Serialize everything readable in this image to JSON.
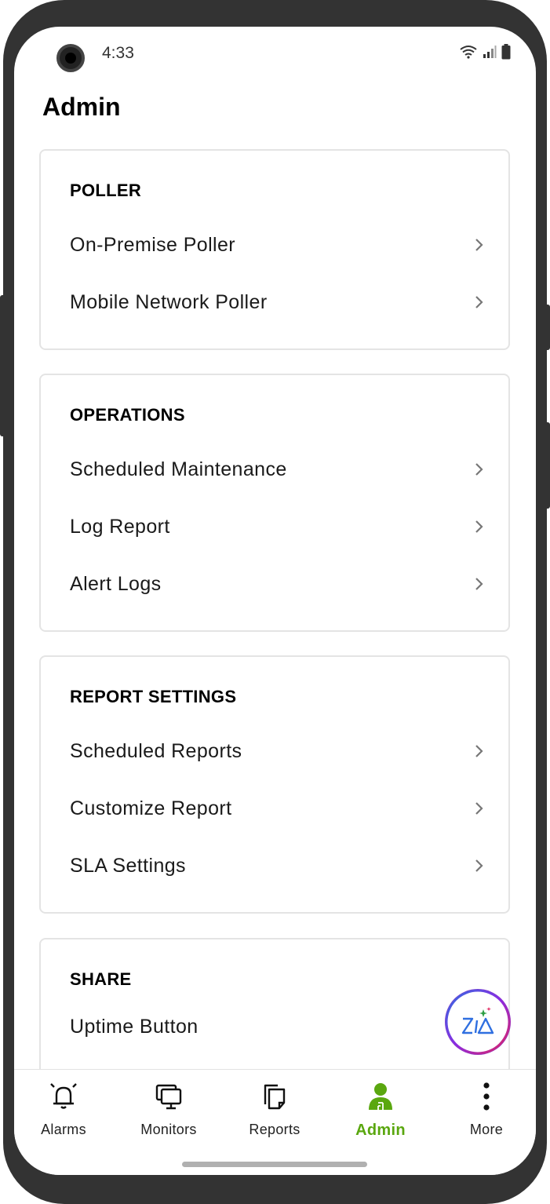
{
  "status_bar": {
    "time": "4:33"
  },
  "page": {
    "title": "Admin"
  },
  "sections": [
    {
      "title": "POLLER",
      "items": [
        "On-Premise Poller",
        "Mobile Network Poller"
      ]
    },
    {
      "title": "OPERATIONS",
      "items": [
        "Scheduled Maintenance",
        "Log Report",
        "Alert Logs"
      ]
    },
    {
      "title": "REPORT SETTINGS",
      "items": [
        "Scheduled Reports",
        "Customize Report",
        "SLA Settings"
      ]
    },
    {
      "title": "SHARE",
      "items": [
        "Uptime Button"
      ]
    }
  ],
  "bottom_nav": {
    "active": "Admin",
    "items": [
      {
        "label": "Alarms",
        "icon": "bell-icon"
      },
      {
        "label": "Monitors",
        "icon": "monitor-icon"
      },
      {
        "label": "Reports",
        "icon": "reports-icon"
      },
      {
        "label": "Admin",
        "icon": "admin-user-icon"
      },
      {
        "label": "More",
        "icon": "more-vertical-icon"
      }
    ]
  },
  "colors": {
    "active": "#5aa70f",
    "text": "#1a1a1a",
    "card_border": "#e4e4e4",
    "frame": "#333333"
  }
}
